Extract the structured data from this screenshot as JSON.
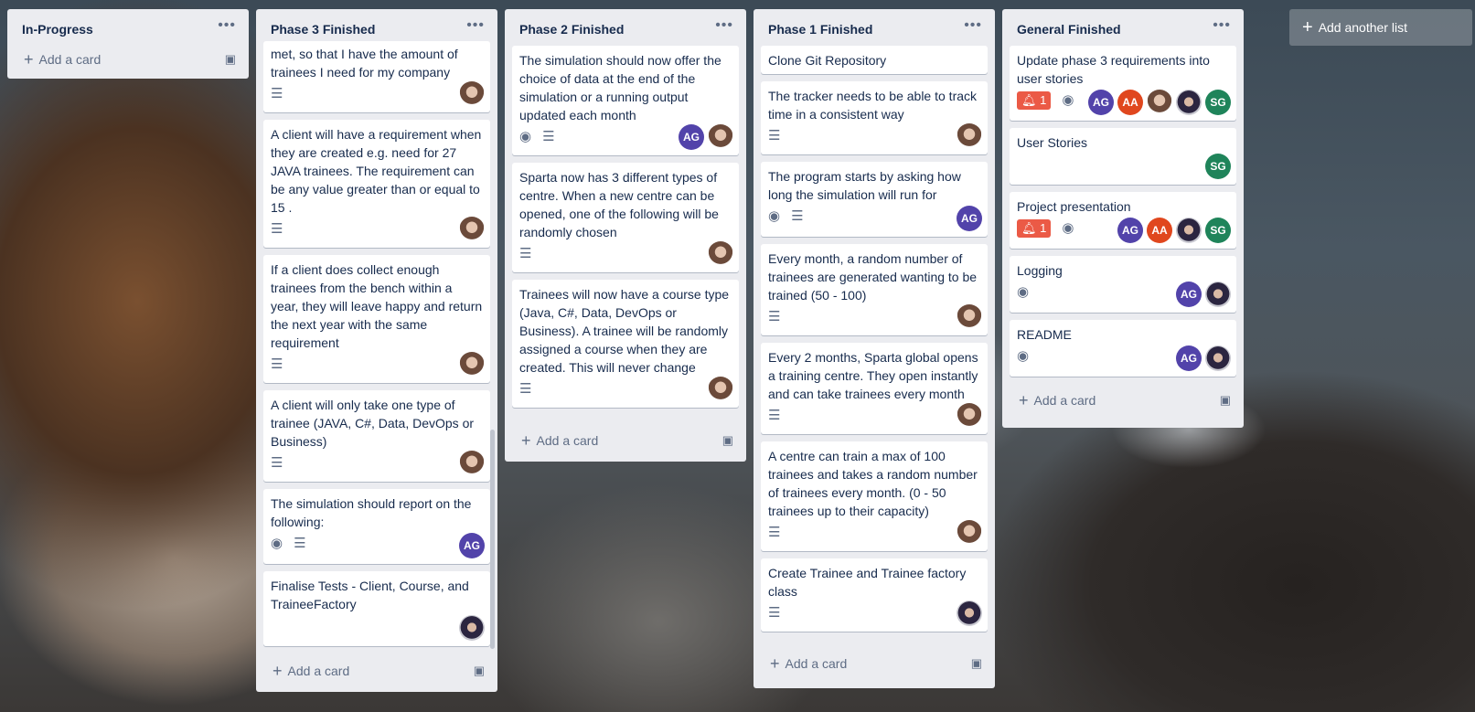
{
  "board": {
    "add_list_label": "Add another list"
  },
  "lists": {
    "in_progress": {
      "title": "In-Progress",
      "add_card": "Add a card"
    },
    "phase3": {
      "title": "Phase 3 Finished",
      "add_card": "Add a card",
      "cards": [
        {
          "text": "met, so that I have the amount of trainees I need for my company"
        },
        {
          "text": "A client will have a requirement when they are created e.g. need for 27 JAVA trainees. The requirement can be any value greater than or equal to 15 ."
        },
        {
          "text": "If a client does collect enough trainees from the bench within a year, they will leave happy and return the next year with the same requirement"
        },
        {
          "text": "A client will only take one type of trainee (JAVA, C#, Data, DevOps or Business)"
        },
        {
          "text": "The simulation should report on the following:",
          "member": "AG"
        },
        {
          "text": "Finalise Tests - Client, Course, and TraineeFactory"
        }
      ]
    },
    "phase2": {
      "title": "Phase 2 Finished",
      "add_card": "Add a card",
      "cards": [
        {
          "text": "The simulation should now offer the choice of data at the end of the simulation or a running output updated each month",
          "member": "AG"
        },
        {
          "text": "Sparta now has 3 different types of centre. When a new centre can be opened, one of the following will be randomly chosen"
        },
        {
          "text": "Trainees will now have a course type (Java, C#, Data, DevOps or Business). A trainee will be randomly assigned a course when they are created. This will never change"
        }
      ]
    },
    "phase1": {
      "title": "Phase 1 Finished",
      "add_card": "Add a card",
      "cards": [
        {
          "text": "Clone Git Repository"
        },
        {
          "text": "The tracker needs to be able to track time in a consistent way"
        },
        {
          "text": "The program starts by asking how long the simulation will run for",
          "member": "AG"
        },
        {
          "text": "Every month, a random number of trainees are generated wanting to be trained (50 - 100)"
        },
        {
          "text": "Every 2 months, Sparta global opens a training centre. They open instantly and can take trainees every month"
        },
        {
          "text": "A centre can train a max of 100 trainees and takes a random number of trainees every month. (0 - 50 trainees up to their capacity)"
        },
        {
          "text": "Create Trainee and Trainee factory class"
        }
      ]
    },
    "general": {
      "title": "General Finished",
      "add_card": "Add a card",
      "cards": [
        {
          "text": "Update phase 3 requirements into user stories",
          "alert": "1",
          "members": [
            "AG",
            "AA",
            "SG"
          ]
        },
        {
          "text": "User Stories",
          "members": [
            "SG"
          ]
        },
        {
          "text": "Project presentation",
          "alert": "1",
          "members": [
            "AG",
            "AA",
            "SG"
          ]
        },
        {
          "text": "Logging",
          "members": [
            "AG"
          ]
        },
        {
          "text": "README",
          "members": [
            "AG"
          ]
        }
      ]
    }
  },
  "icons": {
    "menu": "more-horizontal-icon",
    "plus": "plus-icon",
    "template": "card-template-icon",
    "description": "description-icon",
    "watch": "eye-icon",
    "alert": "bell-icon"
  },
  "colors": {
    "list_bg": "#ebecf0",
    "avatar_ag": "#5243aa",
    "avatar_aa": "#e0471e",
    "avatar_sg": "#1f845a",
    "alert_badge": "#eb5a46"
  }
}
